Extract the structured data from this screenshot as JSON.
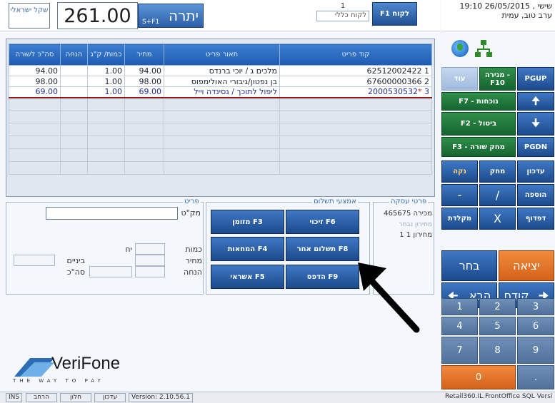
{
  "header": {
    "currency": "שקל ישראלי",
    "amount": "261.00",
    "balance_label": "יתרה",
    "balance_shortcut": "S+F1",
    "customer_number": "1",
    "customer_name": "לקוח כללי",
    "customer_button": "F1 לקוח"
  },
  "datetime": {
    "line1": "שישי , 26/05/2015 19:10",
    "line2": "ערב טוב,      עמית"
  },
  "grid": {
    "headers": [
      "קוד פריט",
      "תאור פריט",
      "מחיר",
      "כמות/ ק\"ג",
      "הנחה",
      "סה\"כ לשורה"
    ],
    "rows": [
      {
        "n": "1",
        "code": "62512002422",
        "desc": "מלכים ג / יוכי ברנדס",
        "price": "94.00",
        "qty": "1.00",
        "disc": "",
        "total": "94.00"
      },
      {
        "n": "2",
        "code": "67600000366",
        "desc": "בן נפטון/גיבורי האולימפוס",
        "price": "98.00",
        "qty": "1.00",
        "disc": "",
        "total": "98.00"
      },
      {
        "n": "3",
        "code": "2000530532",
        "desc": "ליפול לתוכך / גסינדה וייל",
        "price": "69.00",
        "qty": "1.00",
        "disc": "",
        "total": "69.00"
      }
    ]
  },
  "fields": {
    "section_label": "פריט",
    "sku_label": "מק\"ט",
    "qty_label": "כמות",
    "price_label": "מחיר",
    "discount_label": "הנחה",
    "unit_label": "יח",
    "intermediate_label": "ביניים",
    "total_label": "סה\"כ"
  },
  "payment": {
    "section_label": "אמצעי תשלום",
    "buttons": [
      "זיכוי F6",
      "מזומן F3",
      "תשלום אחר F8",
      "המחאות F4",
      "הדפס F9",
      "אשראי F5"
    ]
  },
  "deal": {
    "title": "פרטי עסקה",
    "line1": "465675 מכירה",
    "line2": "מחירון נבחר",
    "line3": "1  מחירון 1"
  },
  "keypad": {
    "row1": [
      "עוד",
      "מגירה - F10",
      "PGUP"
    ],
    "row2": [
      "F7 - נוכחות"
    ],
    "row3": [
      "F2 - ביטול"
    ],
    "row4": [
      "F3 - מחק שורה",
      "PGDN"
    ],
    "row5": [
      "נקה",
      "מחק",
      "עדכון"
    ],
    "row6": [
      "-",
      "/",
      "הוספה"
    ],
    "row7": [
      "מקלדת",
      "X",
      "דפדוף"
    ],
    "choose": "בחר",
    "exit": "יציאה",
    "next": "הבא",
    "prev": "קודם",
    "nums": [
      "1",
      "2",
      "3",
      "4",
      "5",
      "6",
      "7",
      "8",
      "9"
    ],
    "zero": "0",
    "dot": "."
  },
  "logo": {
    "name": "VeriFone",
    "tagline": "THE WAY TO PAY"
  },
  "status": {
    "ins": "INS",
    "expand": "הרחב",
    "window": "חלון",
    "update": "עדכון",
    "version": "Version: 2.10.56.1",
    "app": "Retail360.IL.FrontOffice SQL Versi"
  },
  "colors": {
    "accent_blue": "#1c4a8c",
    "accent_green": "#156530",
    "accent_orange": "#d4621a"
  }
}
